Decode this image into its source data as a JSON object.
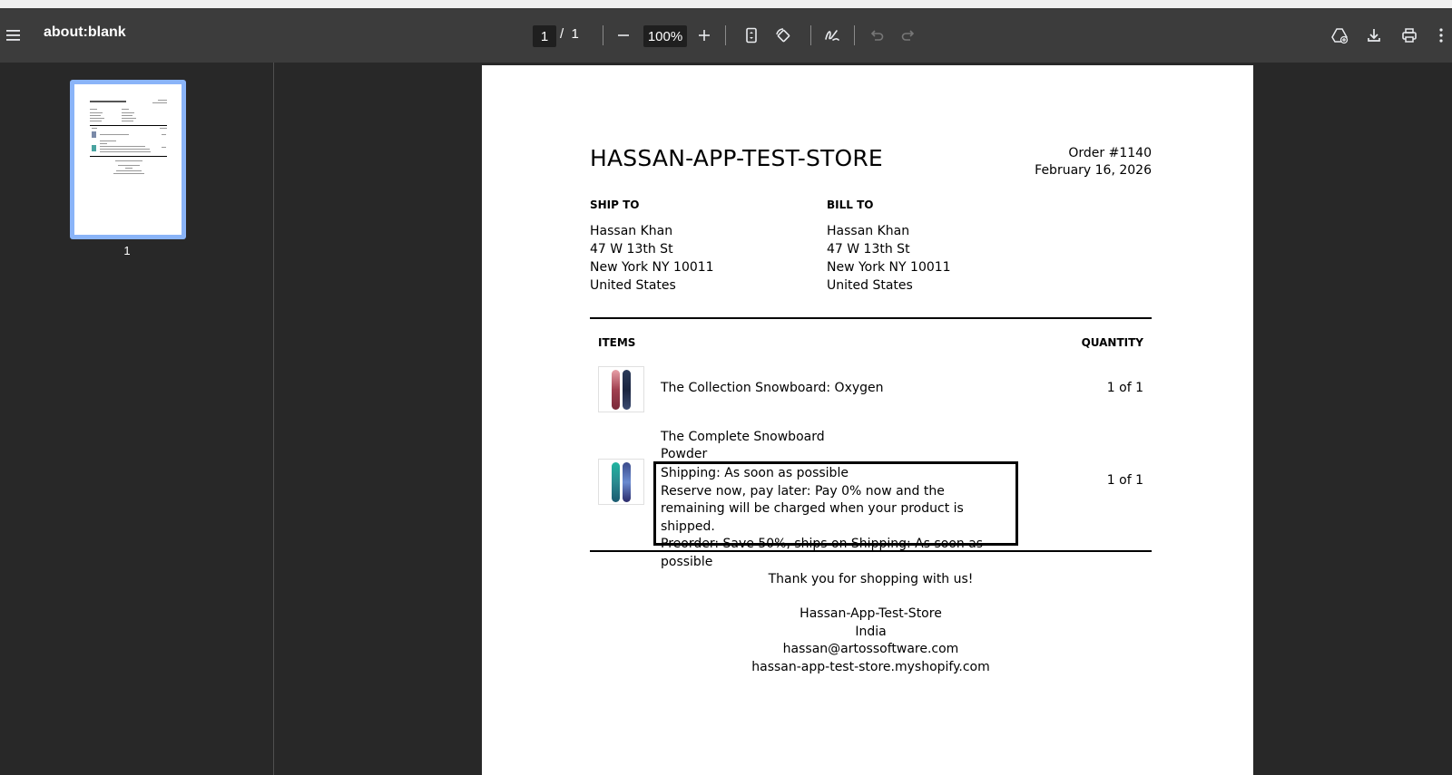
{
  "toolbar": {
    "title": "about:blank",
    "current_page": "1",
    "page_separator": "/",
    "total_pages": "1",
    "zoom": "100%"
  },
  "sidebar": {
    "thumbnail_number": "1"
  },
  "document": {
    "store_name": "HASSAN-APP-TEST-STORE",
    "order_number": "Order #1140",
    "order_date": "February 16, 2026",
    "ship_to": {
      "label": "SHIP TO",
      "lines": [
        "Hassan Khan",
        "47 W 13th St",
        "New York NY 10011",
        "United States"
      ]
    },
    "bill_to": {
      "label": "BILL TO",
      "lines": [
        "Hassan Khan",
        "47 W 13th St",
        "New York NY 10011",
        "United States"
      ]
    },
    "items_header": "ITEMS",
    "quantity_header": "QUANTITY",
    "items": [
      {
        "name": "The Collection Snowboard: Oxygen",
        "quantity": "1 of 1"
      },
      {
        "name_line1": "The Complete Snowboard",
        "name_line2": "Powder",
        "details": [
          "Shipping: As soon as possible",
          "Reserve now, pay later: Pay 0% now and the remaining will be charged when your product is shipped.",
          "Preorder: Save 50%, ships on Shipping: As soon as possible"
        ],
        "quantity": "1 of 1"
      }
    ],
    "footer": {
      "thanks": "Thank you for shopping with us!",
      "store": "Hassan-App-Test-Store",
      "country": "India",
      "email": "hassan@artossoftware.com",
      "website": "hassan-app-test-store.myshopify.com"
    }
  },
  "icons": [
    "menu-icon",
    "zoom-out-icon",
    "zoom-in-icon",
    "fit-page-icon",
    "rotate-icon",
    "annotate-icon",
    "undo-icon",
    "redo-icon",
    "drive-icon",
    "download-icon",
    "print-icon",
    "more-icon"
  ]
}
